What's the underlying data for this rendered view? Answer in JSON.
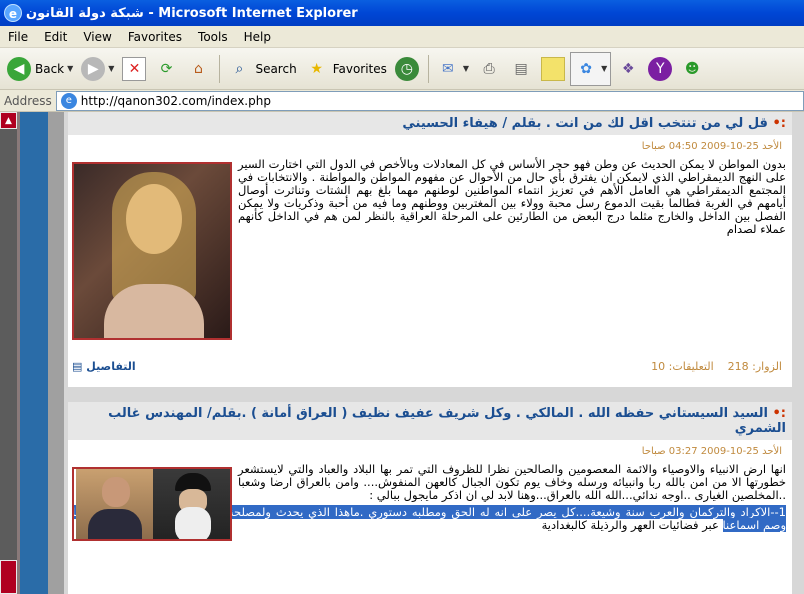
{
  "window": {
    "title": "شبكة دولة القانون - Microsoft Internet Explorer"
  },
  "menu": [
    "File",
    "Edit",
    "View",
    "Favorites",
    "Tools",
    "Help"
  ],
  "toolbar": {
    "back_label": "Back",
    "search_label": "Search",
    "favorites_label": "Favorites"
  },
  "address": {
    "label": "Address",
    "url": "http://qanon302.com/index.php"
  },
  "articles": [
    {
      "title": "قل لي من تنتخب اقل لك من انت . بقلم / هيفاء الحسيني",
      "date": "الأحد 25-10-2009 04:50 صباحا",
      "body": "بدون المواطن لا يمكن الحديث عن وطن فهو حجر الأساس في كل المعادلات وبالأخص في الدول التي اختارت السير على النهج الديمقراطي الذي لايمكن ان يفترق بأي حال من الأحوال عن مفهوم المواطن والمواطنة . والانتخابات في المجتمع الديمقراطي هي العامل الأهم في تعزيز انتماء المواطنين لوطنهم مهما بلغ بهم الشتات وتناثرت أوصال أيامهم في الغربة فطالما بقيت الدموع رسل محبة وولاء بين المغتربين ووطنهم وما فيه من أحبة وذكريات ولا يمكن الفصل بين الداخل والخارج مثلما درج البعض من الطارئين على المرحلة العراقية بالنظر لمن هم في الداخل كأنهم عملاء لصدام",
      "visits": "الزوار: 218",
      "comments": "التعليقات: 10",
      "details": "التفاصيل"
    },
    {
      "title": "السيد السيستاني حفظه الله . المالكي . وكل شريف عفيف نظيف ( العراق أمانة ) .بقلم/ المهندس غالب الشمري",
      "date": "الأحد 25-10-2009 03:27 صباحا",
      "body": "انها ارض الانبياء والاوصياء والائمة المعصومين والصالحين نظرا للظروف التي تمر بها البلاد والعباد والتي لايستشعر خطورتها الا من امن بالله ربا وانبيائه ورسله وخاف يوم تكون الجبال كالعهن المنفوش.... وامن بالعراق ارضا وشعبا ..المخلصين الغيارى ..اوجه ندائي...الله الله بالعراق...وهنا لابد لي ان اذكر مايجول ببالي :",
      "highlight": "1--الاكراد والتركمان والعرب سنة وشيعة....كل يصر على انه له الحق ومطلبه دستوري .ماهذا الذي يحدث ولمصلحة من هرائكم الذي اقض مضاجعنا وصم اسماعنا",
      "tail": "عبر فضائيات العهر والرذيلة كالبغدادية"
    }
  ],
  "colors": {
    "title_bar": "#0046d5",
    "link_blue": "#1b4e91",
    "date_gold": "#c08a3e",
    "scroll_red": "#b00020",
    "highlight": "#316ac5"
  }
}
